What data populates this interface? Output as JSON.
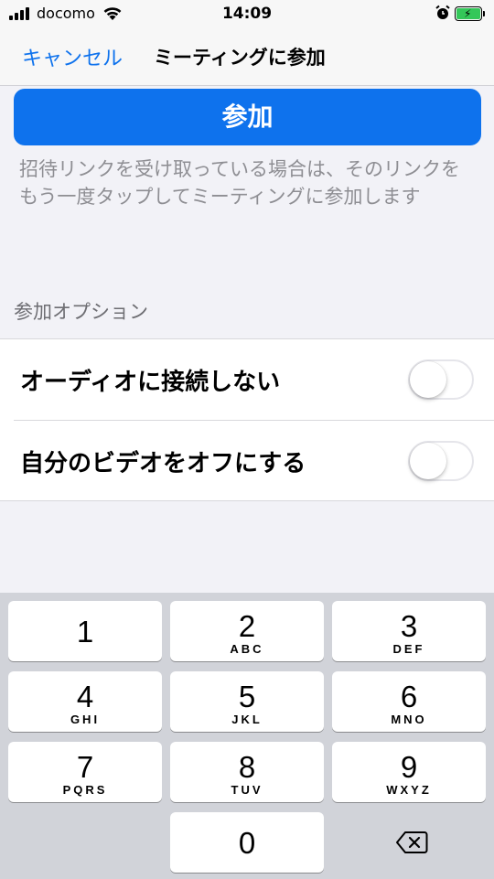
{
  "status_bar": {
    "carrier": "docomo",
    "time": "14:09",
    "icons": [
      "signal-icon",
      "wifi-icon",
      "alarm-icon",
      "battery-charging-icon"
    ],
    "battery_color": "#34c759"
  },
  "nav": {
    "cancel_label": "キャンセル",
    "title": "ミーティングに参加"
  },
  "join_button_label": "参加",
  "hint_text": "招待リンクを受け取っている場合は、そのリンクをもう一度タップしてミーティングに参加します",
  "options": {
    "header": "参加オプション",
    "items": [
      {
        "label": "オーディオに接続しない",
        "enabled": false
      },
      {
        "label": "自分のビデオをオフにする",
        "enabled": false
      }
    ]
  },
  "keypad": {
    "keys": [
      {
        "num": "1",
        "letters": ""
      },
      {
        "num": "2",
        "letters": "ABC"
      },
      {
        "num": "3",
        "letters": "DEF"
      },
      {
        "num": "4",
        "letters": "GHI"
      },
      {
        "num": "5",
        "letters": "JKL"
      },
      {
        "num": "6",
        "letters": "MNO"
      },
      {
        "num": "7",
        "letters": "PQRS"
      },
      {
        "num": "8",
        "letters": "TUV"
      },
      {
        "num": "9",
        "letters": "WXYZ"
      },
      {
        "num": "0",
        "letters": ""
      }
    ],
    "delete_icon": "backspace-icon"
  },
  "colors": {
    "accent": "#0e72ed",
    "background": "#f2f2f7",
    "keypad_bg": "#d1d3d9"
  }
}
